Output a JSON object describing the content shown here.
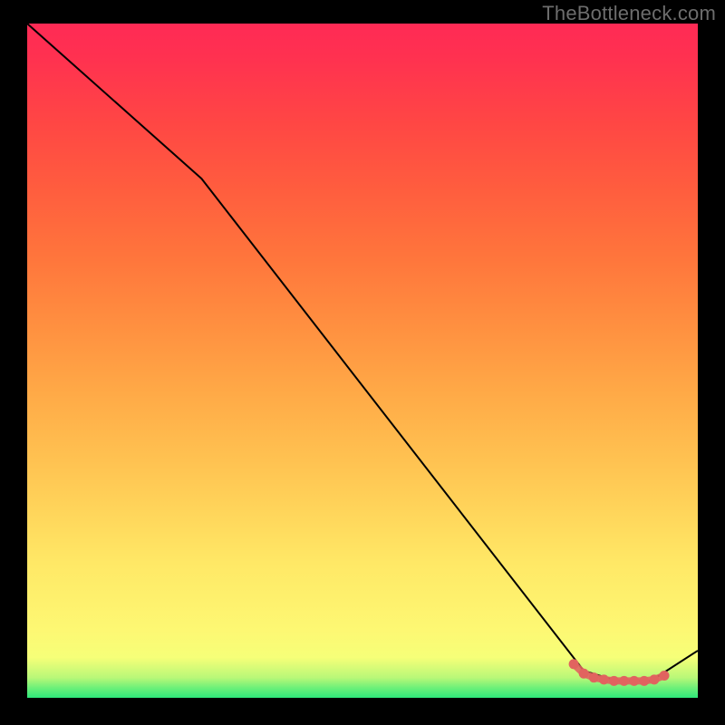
{
  "watermark": "TheBottleneck.com",
  "chart_data": {
    "type": "line",
    "title": "",
    "xlabel": "",
    "ylabel": "",
    "xlim": [
      0,
      100
    ],
    "ylim": [
      0,
      100
    ],
    "grid": false,
    "legend": false,
    "series": [
      {
        "name": "curve",
        "x": [
          0,
          26,
          83,
          88,
          93,
          100
        ],
        "y": [
          100,
          77,
          4,
          2.5,
          2.5,
          7
        ]
      }
    ],
    "markers": {
      "name": "highlight-band",
      "color": "#e1635f",
      "points": [
        {
          "x": 81.5,
          "y": 5.0
        },
        {
          "x": 83.0,
          "y": 3.6
        },
        {
          "x": 84.5,
          "y": 3.0
        },
        {
          "x": 86.0,
          "y": 2.7
        },
        {
          "x": 87.5,
          "y": 2.5
        },
        {
          "x": 89.0,
          "y": 2.5
        },
        {
          "x": 90.5,
          "y": 2.5
        },
        {
          "x": 92.0,
          "y": 2.5
        },
        {
          "x": 93.5,
          "y": 2.7
        },
        {
          "x": 95.0,
          "y": 3.3
        }
      ]
    },
    "background_gradient": {
      "top": "#ff2a55",
      "bottom": "#2ee87a"
    }
  }
}
